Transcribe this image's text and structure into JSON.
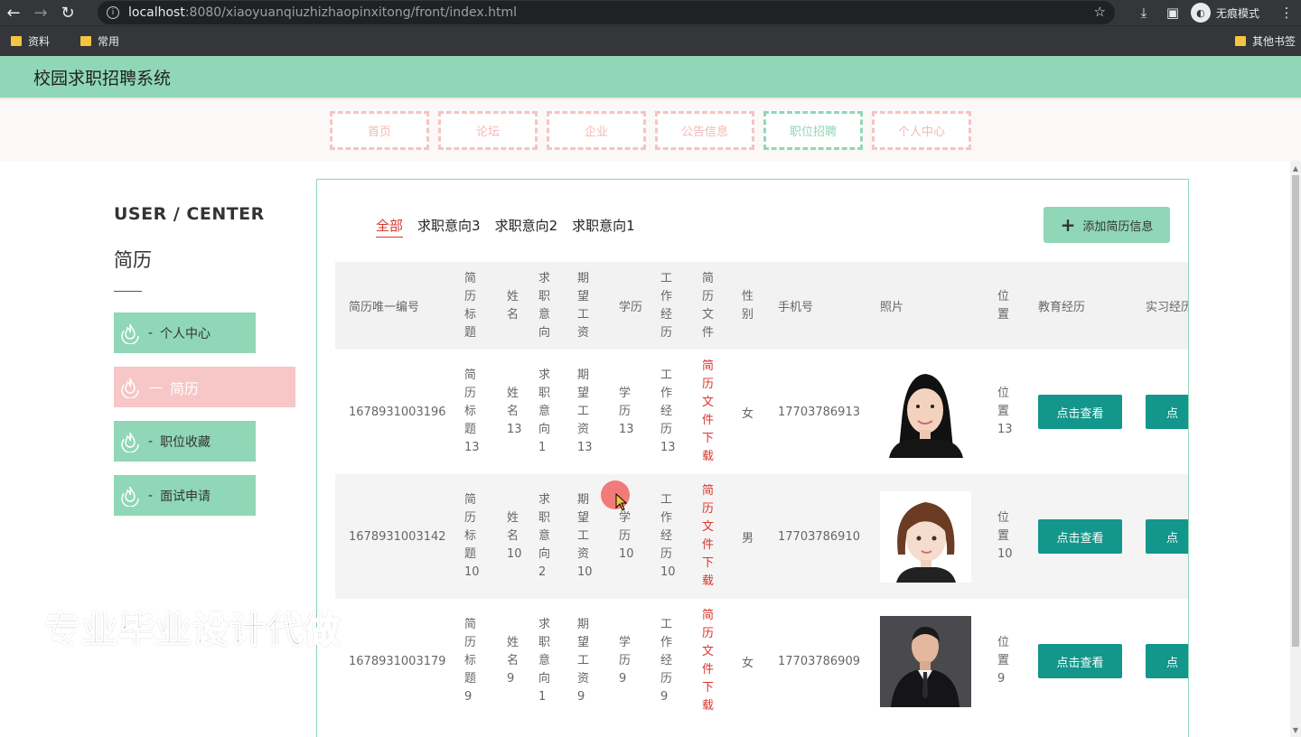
{
  "browser": {
    "url_host": "localhost",
    "url_path": ":8080/xiaoyuanqiuzhizhaopinxitong/front/index.html",
    "incognito_label": "无痕模式"
  },
  "bookmarks": {
    "items": [
      {
        "label": "资料"
      },
      {
        "label": "常用"
      }
    ],
    "other": "其他书签"
  },
  "site": {
    "title": "校园求职招聘系统"
  },
  "nav": {
    "items": [
      {
        "label": "首页"
      },
      {
        "label": "论坛"
      },
      {
        "label": "企业"
      },
      {
        "label": "公告信息"
      },
      {
        "label": "职位招聘"
      },
      {
        "label": "个人中心"
      }
    ],
    "active_index": 4
  },
  "sidebar": {
    "title": "USER / CENTER",
    "subtitle": "简历",
    "items": [
      {
        "label": "个人中心",
        "dash": "-"
      },
      {
        "label": "简历",
        "dash": "—"
      },
      {
        "label": "职位收藏",
        "dash": "-"
      },
      {
        "label": "面试申请",
        "dash": "-"
      }
    ],
    "active_index": 1
  },
  "tabs": {
    "items": [
      {
        "label": "全部"
      },
      {
        "label": "求职意向3"
      },
      {
        "label": "求职意向2"
      },
      {
        "label": "求职意向1"
      }
    ],
    "active_index": 0
  },
  "add_button": {
    "label": "添加简历信息"
  },
  "table": {
    "headers": {
      "id": "简历唯一编号",
      "title": "简历标题",
      "name": "姓名",
      "intent": "求职意向",
      "salary": "期望工资",
      "edu": "学历",
      "exp": "工作经历",
      "file": "简历文件",
      "gender": "性别",
      "phone": "手机号",
      "photo": "照片",
      "loc": "位置",
      "edu_hist": "教育经历",
      "intern": "实习经历"
    },
    "rows": [
      {
        "id": "1678931003196",
        "title": "简历标题13",
        "name": "姓名13",
        "intent": "求职意向1",
        "salary": "期望工资13",
        "edu": "学历13",
        "exp": "工作经历13",
        "file": "简历文件下载",
        "gender": "女",
        "phone": "17703786913",
        "loc": "位置13",
        "view": "点击查看",
        "view2": "点"
      },
      {
        "id": "1678931003142",
        "title": "简历标题10",
        "name": "姓名10",
        "intent": "求职意向2",
        "salary": "期望工资10",
        "edu": "学历10",
        "exp": "工作经历10",
        "file": "简历文件下载",
        "gender": "男",
        "phone": "17703786910",
        "loc": "位置10",
        "view": "点击查看",
        "view2": "点"
      },
      {
        "id": "1678931003179",
        "title": "简历标题9",
        "name": "姓名9",
        "intent": "求职意向1",
        "salary": "期望工资9",
        "edu": "学历9",
        "exp": "工作经历9",
        "file": "简历文件下载",
        "gender": "女",
        "phone": "17703786909",
        "loc": "位置9",
        "view": "点击查看",
        "view2": "点"
      }
    ]
  },
  "watermark": "专业毕业设计代做",
  "colors": {
    "accent_green": "#8fd7b6",
    "accent_pink": "#f7c6c6",
    "teal_button": "#13968b",
    "link_red": "#d9362f"
  }
}
